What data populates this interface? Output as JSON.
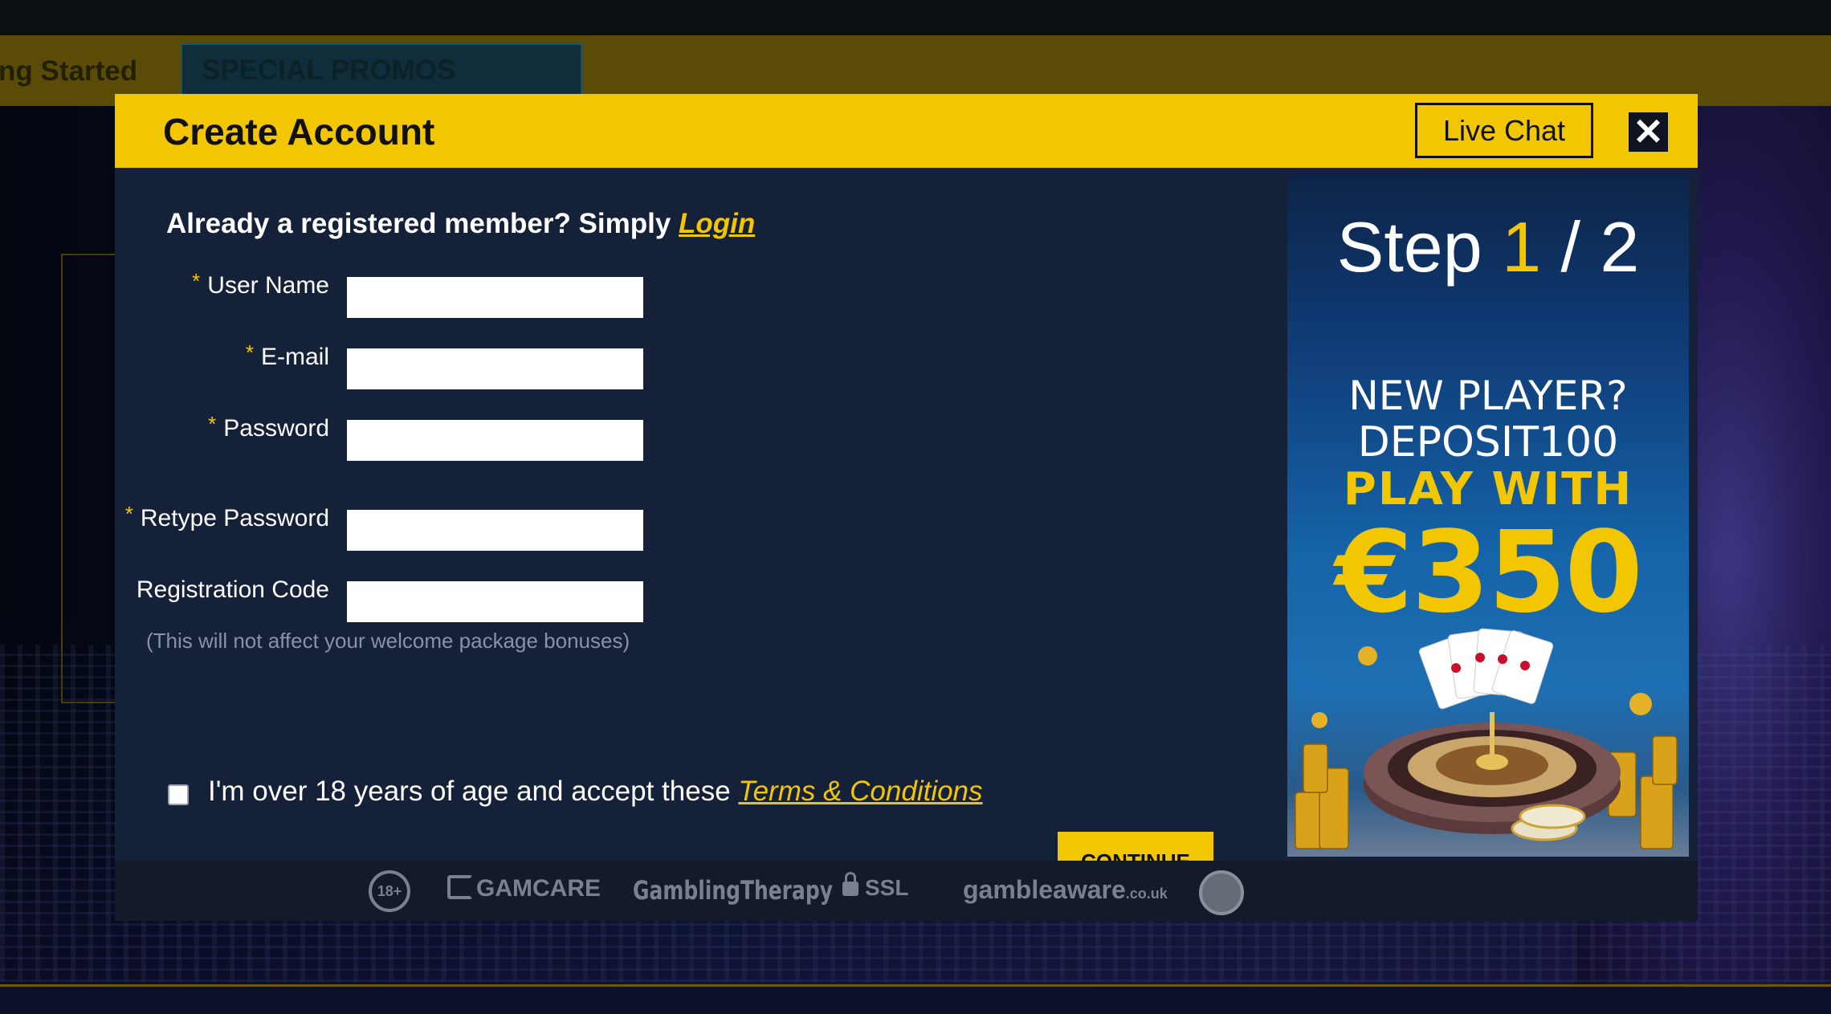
{
  "background": {
    "nav_items": [
      "ng Started",
      "SPECIAL PROMOS"
    ]
  },
  "modal": {
    "title": "Create Account",
    "live_chat_label": "Live Chat",
    "close_label": "✕",
    "already_text": "Already a registered member? Simply ",
    "login_label": "Login",
    "fields": [
      {
        "label": "User Name",
        "required": true,
        "value": ""
      },
      {
        "label": "E-mail",
        "required": true,
        "value": ""
      },
      {
        "label": "Password",
        "required": true,
        "value": ""
      },
      {
        "label": "Retype Password",
        "required": true,
        "value": ""
      },
      {
        "label": "Registration Code",
        "required": false,
        "value": ""
      }
    ],
    "required_marker": "*",
    "registration_hint": "(This will not affect your welcome package bonuses)",
    "terms_text": "I'm over 18 years of age and accept these ",
    "terms_link": "Terms & Conditions",
    "terms_checked": false,
    "continue_label": "CONTINUE"
  },
  "promo": {
    "step_word": "Step ",
    "step_current": "1",
    "step_sep": " / ",
    "step_total": "2",
    "line1": "NEW PLAYER?",
    "line2": "DEPOSIT100",
    "line3": "PLAY WITH",
    "line4": "€350"
  },
  "footer_badges": {
    "age": "18+",
    "gamcare": "GAMCARE",
    "therapy": "GamblingTherapy",
    "ssl": "SSL",
    "gambleaware": "gambleaware",
    "gambleaware_suffix": ".co.uk"
  },
  "colors": {
    "accent": "#f2c600",
    "modal_bg": "#152138",
    "header_bg": "#f2c600"
  }
}
